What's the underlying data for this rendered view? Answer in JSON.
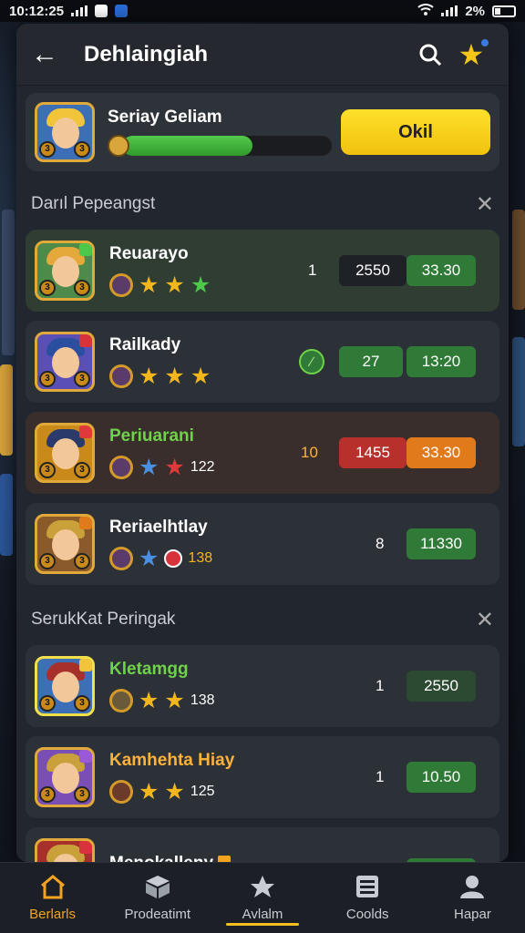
{
  "status_bar": {
    "time": "10:12:25",
    "battery": "2%"
  },
  "header": {
    "title": "Dehlaingiah"
  },
  "player": {
    "name": "Seriay Geliam",
    "xp_progress": 0.62,
    "ok_label": "Okil"
  },
  "section1": {
    "title": "Darıl Pepeangst",
    "rows": [
      {
        "name": "Reuarayo",
        "rank": "1",
        "chip1": "2550",
        "chip2": "33.30"
      },
      {
        "name": "Railkady",
        "chip1": "27",
        "chip2": "13:20"
      },
      {
        "name": "Periuarani",
        "stat": "122",
        "rank": "10",
        "chip1": "1455",
        "chip2": "33.30"
      },
      {
        "name": "Reriaelhtlay",
        "stat": "138",
        "rank": "8",
        "chip2": "11330"
      }
    ]
  },
  "section2": {
    "title": "SerukKat Peringak",
    "rows": [
      {
        "name": "Kletamgg",
        "stat": "138",
        "rank": "1",
        "chip2": "2550"
      },
      {
        "name": "Kamhehta Hiay",
        "stat": "125",
        "rank": "1",
        "chip2": "10.50"
      },
      {
        "name": "Menokalleny"
      }
    ]
  },
  "nav": [
    "Berlarls",
    "Prodeatimt",
    "Avlalm",
    "Coolds",
    "Hapar"
  ],
  "colors": {
    "accent": "#f2c020",
    "green": "#2f7a36",
    "panel": "#22262e"
  }
}
